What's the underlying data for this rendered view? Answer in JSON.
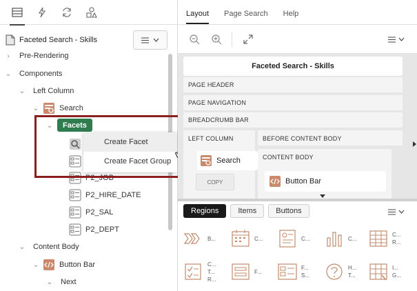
{
  "left": {
    "tabs": [
      "rendering-tab",
      "dynamic-actions-tab",
      "processing-tab",
      "shared-components-tab"
    ],
    "page_title": "Faceted Search - Skills",
    "tree": {
      "pre_rendering": "Pre-Rendering",
      "components": "Components",
      "left_column": "Left Column",
      "search": "Search",
      "facets": "Facets",
      "p2_job": "P2_JOB",
      "p2_hire_date": "P2_HIRE_DATE",
      "p2_sal": "P2_SAL",
      "p2_dept": "P2_DEPT",
      "content_body": "Content Body",
      "button_bar": "Button Bar",
      "next": "Next"
    },
    "context_menu": {
      "create_facet": "Create Facet",
      "create_facet_group": "Create Facet Group"
    }
  },
  "right": {
    "tabs": {
      "layout": "Layout",
      "page_search": "Page Search",
      "help": "Help"
    },
    "layout": {
      "page_title": "Faceted Search - Skills",
      "page_header": "PAGE HEADER",
      "page_navigation": "PAGE NAVIGATION",
      "breadcrumb_bar": "BREADCRUMB BAR",
      "left_column": "LEFT COLUMN",
      "before_content_body": "BEFORE CONTENT BODY",
      "content_body": "CONTENT BODY",
      "search_tile": "Search",
      "copy": "COPY",
      "button_bar_tile": "Button Bar"
    },
    "gallery": {
      "tabs": {
        "regions": "Regions",
        "items": "Items",
        "buttons": "Buttons"
      },
      "items": [
        {
          "icon": "breadcrumb-icon",
          "label": "B..."
        },
        {
          "icon": "calendar-icon",
          "label": "C..."
        },
        {
          "icon": "cards-icon",
          "label": "C..."
        },
        {
          "icon": "chart-icon",
          "label": "C..."
        },
        {
          "icon": "classic-report-icon",
          "label": "C... R..."
        },
        {
          "icon": "checklist-icon",
          "label": "C... T... R..."
        },
        {
          "icon": "form-icon",
          "label": "F..."
        },
        {
          "icon": "facets-icon",
          "label": "F... S..."
        },
        {
          "icon": "help-icon",
          "label": "H... T..."
        },
        {
          "icon": "interactive-grid-icon",
          "label": "I... G..."
        }
      ]
    }
  },
  "colors": {
    "facets_badge": "#2f7d4f",
    "highlight_border": "#8a1f1f",
    "icon_accent": "#c08a6a",
    "active_tab": "#1a1a1a"
  }
}
